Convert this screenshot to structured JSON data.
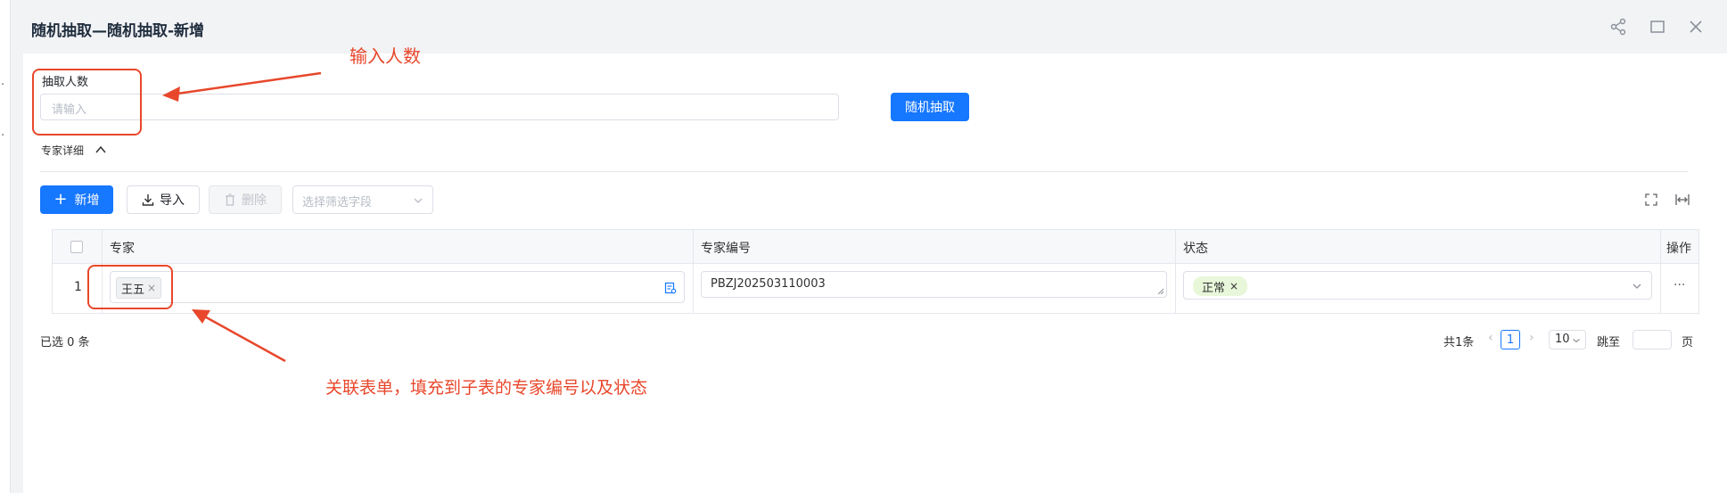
{
  "window": {
    "title": "随机抽取—随机抽取-新增"
  },
  "form": {
    "count_label": "抽取人数",
    "count_placeholder": "请输入",
    "draw_button": "随机抽取"
  },
  "section": {
    "title": "专家详细"
  },
  "toolbar": {
    "add_label": "新增",
    "import_label": "导入",
    "delete_label": "删除",
    "filter_placeholder": "选择筛选字段"
  },
  "table": {
    "columns": [
      "专家",
      "专家编号",
      "状态",
      "操作"
    ],
    "rows": [
      {
        "index": "1",
        "expert": "王五",
        "expert_no": "PBZJ202503110003",
        "status": "正常",
        "actions": "···"
      }
    ]
  },
  "footer": {
    "selected": "已选 0 条",
    "total": "共1条",
    "current_page": "1",
    "page_size": "10",
    "jump_label": "跳至",
    "page_unit": "页"
  },
  "annotations": {
    "input_hint": "输入人数",
    "relation_hint": "关联表单，填充到子表的专家编号以及状态"
  },
  "colors": {
    "primary": "#1677ff",
    "annotation": "#e8472b",
    "status_tag": "#e8f7d9"
  }
}
